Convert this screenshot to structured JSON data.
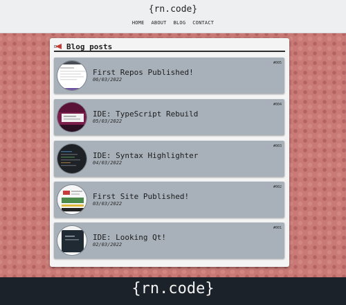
{
  "header": {
    "logo": "{rn.code}",
    "nav": [
      "HOME",
      "ABOUT",
      "BLOG",
      "CONTACT"
    ]
  },
  "blog": {
    "title": "Blog posts",
    "posts": [
      {
        "title": "First Repos Published!",
        "date": "06/03/2022",
        "number": "#005"
      },
      {
        "title": "IDE: TypeScript Rebuild",
        "date": "05/03/2022",
        "number": "#004"
      },
      {
        "title": "IDE: Syntax Highlighter",
        "date": "04/03/2022",
        "number": "#003"
      },
      {
        "title": "First Site Published!",
        "date": "03/03/2022",
        "number": "#002"
      },
      {
        "title": "IDE: Looking Qt!",
        "date": "02/03/2022",
        "number": "#001"
      }
    ]
  },
  "footer": {
    "logo": "{rn.code}"
  },
  "colors": {
    "background": "#c97a76",
    "card": "#a8b1ba",
    "footer": "#1c2229"
  }
}
